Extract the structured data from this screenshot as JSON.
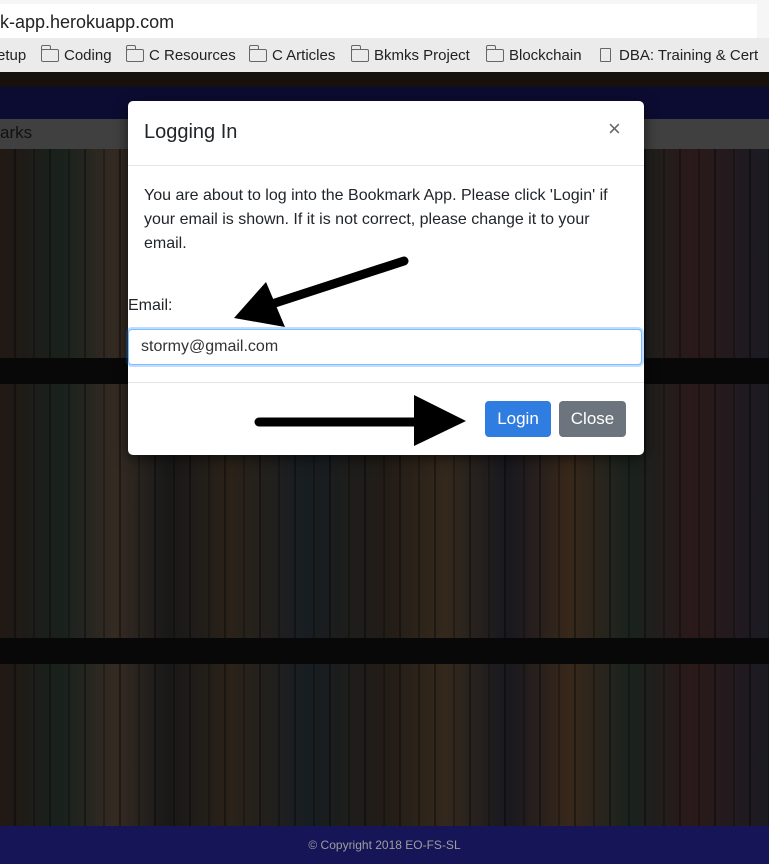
{
  "browser": {
    "url": "k-app.herokuapp.com",
    "bookmarks": [
      {
        "label": "etup",
        "icon": "folder-icon"
      },
      {
        "label": "Coding",
        "icon": "folder-icon"
      },
      {
        "label": "C Resources",
        "icon": "folder-icon"
      },
      {
        "label": "C Articles",
        "icon": "folder-icon"
      },
      {
        "label": "Bkmks Project",
        "icon": "folder-icon"
      },
      {
        "label": "Blockchain",
        "icon": "folder-icon"
      },
      {
        "label": "DBA: Training & Cert",
        "icon": "page-icon"
      }
    ]
  },
  "page": {
    "nav_label": "arks",
    "footer": "© Copyright 2018 EO-FS-SL"
  },
  "modal": {
    "title": "Logging In",
    "close_symbol": "×",
    "body": "You are about to log into the Bookmark App. Please click 'Login' if your email is shown. If it is not correct, please change it to your email.",
    "email_label": "Email:",
    "email_value": "stormy@gmail.com",
    "login_label": "Login",
    "close_label": "Close"
  },
  "colors": {
    "primary": "#2f7de1",
    "secondary": "#6c757d",
    "header_bar": "#161558"
  }
}
